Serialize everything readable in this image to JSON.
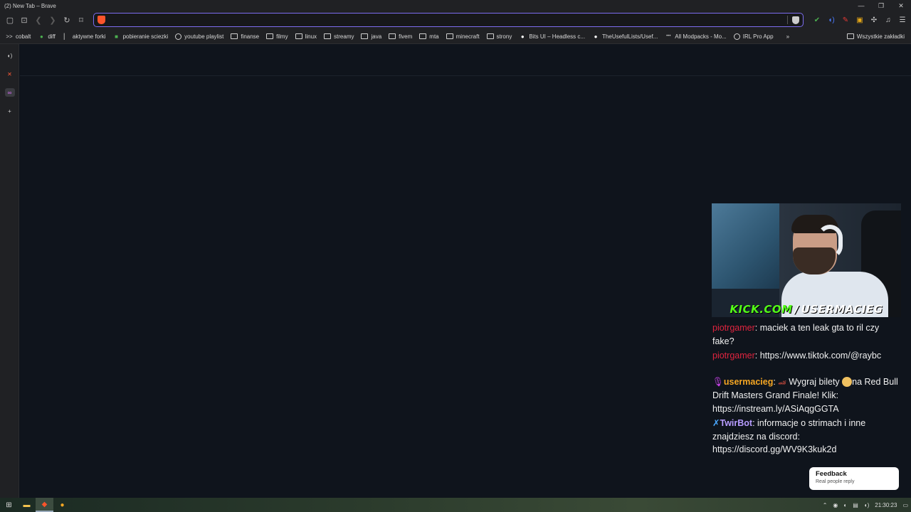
{
  "window": {
    "title": "(2) New Tab – Brave",
    "controls": [
      "—",
      "❐",
      "✕"
    ]
  },
  "toolbar": {
    "address_value": "",
    "address_placeholder": ""
  },
  "bookmarks": [
    {
      "label": "cobalt",
      "icon": ">>"
    },
    {
      "label": "diff",
      "icon": "●"
    },
    {
      "label": "aktywne forki",
      "icon": "▏"
    },
    {
      "label": "pobieranie sciezki",
      "icon": "■"
    },
    {
      "label": "youtube playlist",
      "icon": "globe"
    },
    {
      "label": "finanse",
      "icon": "folder"
    },
    {
      "label": "filmy",
      "icon": "folder"
    },
    {
      "label": "linux",
      "icon": "folder"
    },
    {
      "label": "streamy",
      "icon": "folder"
    },
    {
      "label": "java",
      "icon": "folder"
    },
    {
      "label": "fivem",
      "icon": "folder"
    },
    {
      "label": "mta",
      "icon": "folder"
    },
    {
      "label": "minecraft",
      "icon": "folder"
    },
    {
      "label": "strony",
      "icon": "folder"
    },
    {
      "label": "Bits UI – Headless c...",
      "icon": "●"
    },
    {
      "label": "TheUsefulLists/Usef...",
      "icon": "●"
    },
    {
      "label": "All Modpacks - Mo...",
      "icon": "•••"
    },
    {
      "label": "IRL Pro App",
      "icon": "globe"
    }
  ],
  "bookmarks_overflow": "»",
  "bookmarks_other": "Wszystkie zakładki",
  "stream": {
    "brand_site": "KICK.COM",
    "brand_slash": "/",
    "brand_user": "USERMACIEG"
  },
  "chat": [
    {
      "user": "piotrgamer",
      "text": "maciek a ten leak gta to ril czy fake?"
    },
    {
      "user": "piotrgamer",
      "text": "https://www.tiktok.com/@raybc"
    },
    {
      "user": "usermacieg",
      "text_a": "Wygraj bilety",
      "text_b": "na Red Bull Drift Masters Grand Finale! Klik: https://instream.ly/ASiAqgGGTA"
    },
    {
      "user": "TwirBot",
      "text": "informacje o strimach i inne znajdziesz na discord: https://discord.gg/WV9K3kuk2d"
    }
  ],
  "feedback": {
    "title": "Feedback",
    "subtitle": "Real people reply"
  },
  "taskbar": {
    "time": "21:30:23"
  },
  "colors": {
    "accent": "#7c6df0",
    "kick_green": "#53fc18",
    "chat_red": "#e0243f",
    "chat_orange": "#f5a623",
    "chat_purple": "#b79cff"
  }
}
